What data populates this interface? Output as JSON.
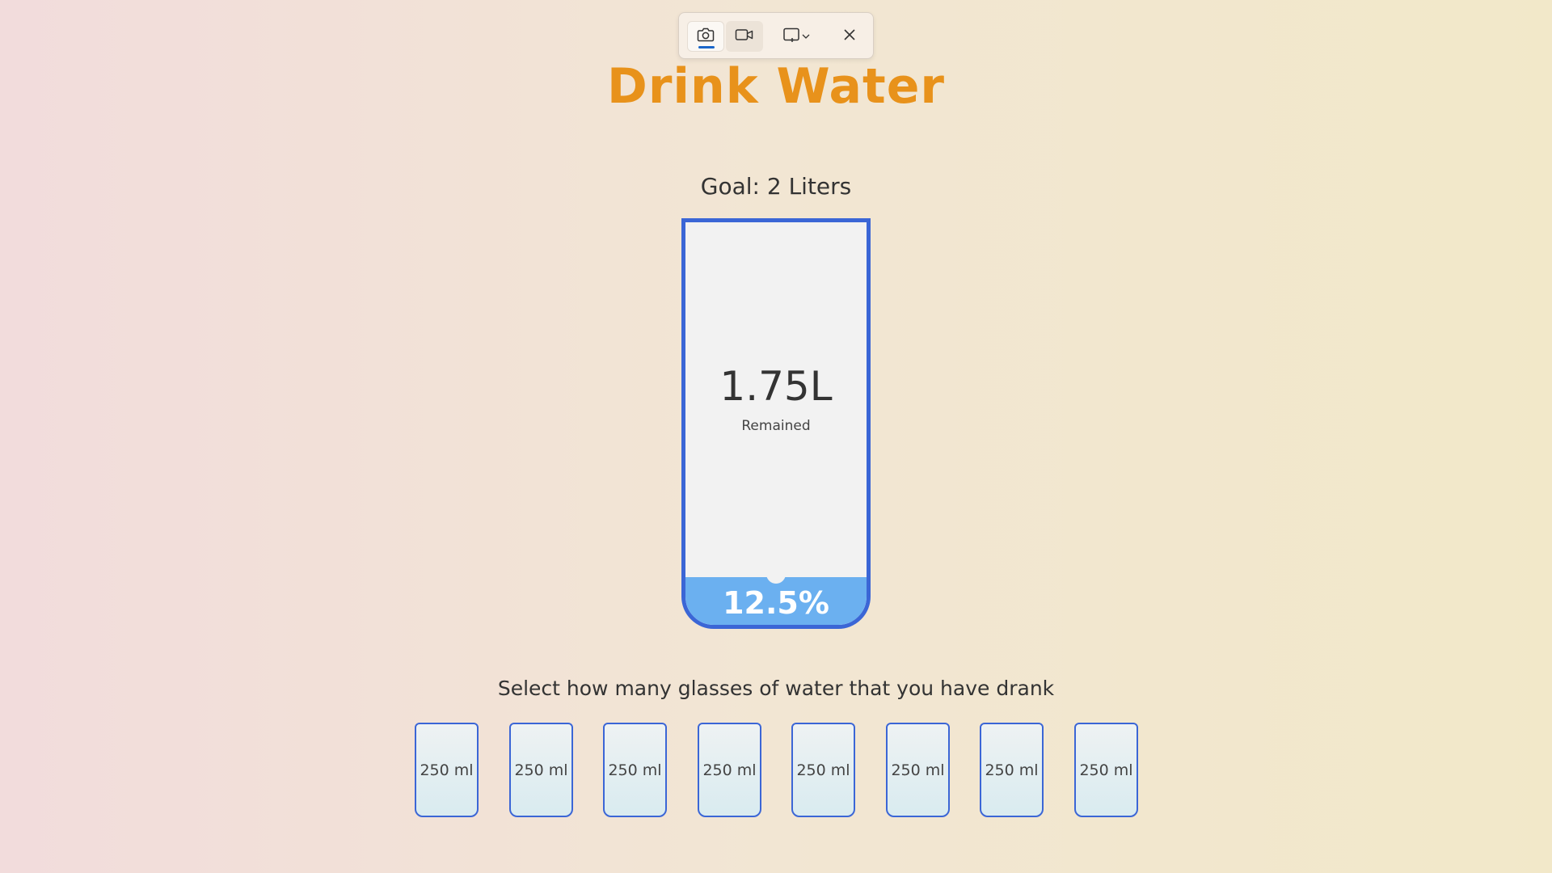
{
  "toolbar": {
    "buttons": [
      {
        "name": "camera-icon",
        "label": "Screenshot mode"
      },
      {
        "name": "video-icon",
        "label": "Video mode"
      },
      {
        "name": "snip-shape-icon",
        "label": "Snip shape"
      },
      {
        "name": "close-icon",
        "label": "Close"
      }
    ]
  },
  "app": {
    "title": "Drink Water",
    "goal": "Goal: 2 Liters",
    "instruction": "Select how many glasses of water that you have drank"
  },
  "big_cup": {
    "remained_value": "1.75L",
    "remained_label": "Remained",
    "percentage_text": "12.5%",
    "fill_fraction": 0.125
  },
  "small_cups": [
    {
      "label": "250 ml",
      "selected": true
    },
    {
      "label": "250 ml",
      "selected": false
    },
    {
      "label": "250 ml",
      "selected": false
    },
    {
      "label": "250 ml",
      "selected": false
    },
    {
      "label": "250 ml",
      "selected": false
    },
    {
      "label": "250 ml",
      "selected": false
    },
    {
      "label": "250 ml",
      "selected": false
    },
    {
      "label": "250 ml",
      "selected": false
    }
  ],
  "colors": {
    "title": "#e8921b",
    "cup_border": "#3b66d6",
    "water": "#6bb0f0",
    "accent": "#1a66c9"
  }
}
